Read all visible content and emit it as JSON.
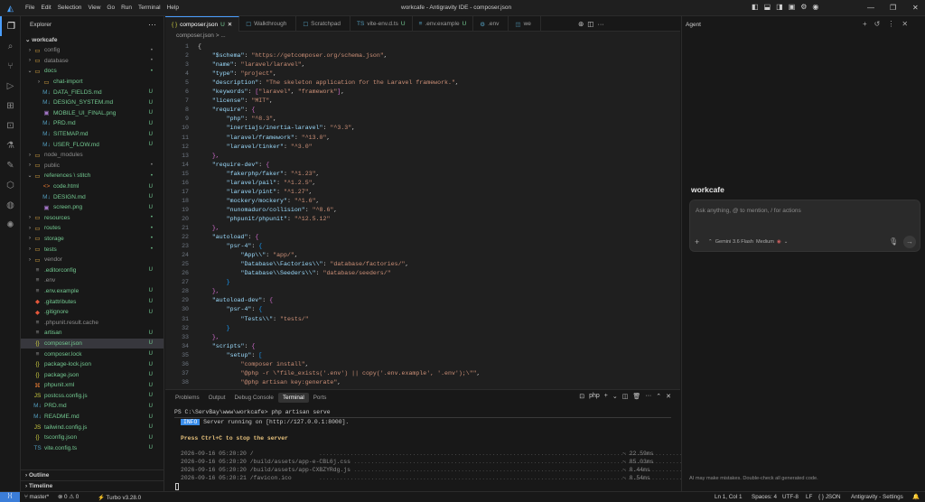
{
  "titlebar": {
    "menu": [
      "File",
      "Edit",
      "Selection",
      "View",
      "Go",
      "Run",
      "Terminal",
      "Help"
    ],
    "title": "workcafe - Antigravity IDE - composer.json"
  },
  "sidebar": {
    "title": "Explorer",
    "workspace": "workcafe",
    "items": [
      {
        "label": "config",
        "depth": 1,
        "kind": "folder",
        "open": false,
        "status": "•",
        "color": "grey"
      },
      {
        "label": "database",
        "depth": 1,
        "kind": "folder",
        "open": false,
        "status": "•",
        "color": "grey"
      },
      {
        "label": "docs",
        "depth": 1,
        "kind": "folder",
        "open": true,
        "status": "•",
        "color": "green"
      },
      {
        "label": "chat-import",
        "depth": 2,
        "kind": "folder",
        "open": false,
        "status": "",
        "color": "green"
      },
      {
        "label": "DATA_FIELDS.md",
        "depth": 2,
        "kind": "md",
        "status": "U",
        "color": "green"
      },
      {
        "label": "DESIGN_SYSTEM.md",
        "depth": 2,
        "kind": "md",
        "status": "U",
        "color": "green"
      },
      {
        "label": "MOBILE_UI_FINAL.png",
        "depth": 2,
        "kind": "png",
        "status": "U",
        "color": "green"
      },
      {
        "label": "PRD.md",
        "depth": 2,
        "kind": "md",
        "status": "U",
        "color": "green"
      },
      {
        "label": "SITEMAP.md",
        "depth": 2,
        "kind": "md",
        "status": "U",
        "color": "green"
      },
      {
        "label": "USER_FLOW.md",
        "depth": 2,
        "kind": "md",
        "status": "U",
        "color": "green"
      },
      {
        "label": "node_modules",
        "depth": 1,
        "kind": "folder",
        "open": false,
        "status": "",
        "color": "grey"
      },
      {
        "label": "public",
        "depth": 1,
        "kind": "folder",
        "open": false,
        "status": "•",
        "color": "grey"
      },
      {
        "label": "references \\ stitch",
        "depth": 1,
        "kind": "folder",
        "open": true,
        "status": "•",
        "color": "green"
      },
      {
        "label": "code.html",
        "depth": 2,
        "kind": "html",
        "status": "U",
        "color": "green"
      },
      {
        "label": "DESIGN.md",
        "depth": 2,
        "kind": "md",
        "status": "U",
        "color": "green"
      },
      {
        "label": "screen.png",
        "depth": 2,
        "kind": "png",
        "status": "U",
        "color": "green"
      },
      {
        "label": "resources",
        "depth": 1,
        "kind": "folder",
        "open": false,
        "status": "•",
        "color": "green"
      },
      {
        "label": "routes",
        "depth": 1,
        "kind": "folder",
        "open": false,
        "status": "•",
        "color": "green"
      },
      {
        "label": "storage",
        "depth": 1,
        "kind": "folder",
        "open": false,
        "status": "•",
        "color": "green"
      },
      {
        "label": "tests",
        "depth": 1,
        "kind": "folder",
        "open": false,
        "status": "•",
        "color": "green"
      },
      {
        "label": "vendor",
        "depth": 1,
        "kind": "folder",
        "open": false,
        "status": "",
        "color": "grey"
      },
      {
        "label": ".editorconfig",
        "depth": 1,
        "kind": "cfg",
        "status": "U",
        "color": "green"
      },
      {
        "label": ".env",
        "depth": 1,
        "kind": "cfg",
        "status": "",
        "color": "grey"
      },
      {
        "label": ".env.example",
        "depth": 1,
        "kind": "cfg",
        "status": "U",
        "color": "green"
      },
      {
        "label": ".gitattributes",
        "depth": 1,
        "kind": "git",
        "status": "U",
        "color": "green"
      },
      {
        "label": ".gitignore",
        "depth": 1,
        "kind": "git",
        "status": "U",
        "color": "green"
      },
      {
        "label": ".phpunit.result.cache",
        "depth": 1,
        "kind": "cfg",
        "status": "",
        "color": "grey"
      },
      {
        "label": "artisan",
        "depth": 1,
        "kind": "cfg",
        "status": "U",
        "color": "green"
      },
      {
        "label": "composer.json",
        "depth": 1,
        "kind": "json",
        "status": "U",
        "color": "green",
        "selected": true
      },
      {
        "label": "composer.lock",
        "depth": 1,
        "kind": "cfg",
        "status": "U",
        "color": "green"
      },
      {
        "label": "package-lock.json",
        "depth": 1,
        "kind": "json",
        "status": "U",
        "color": "green"
      },
      {
        "label": "package.json",
        "depth": 1,
        "kind": "json",
        "status": "U",
        "color": "green"
      },
      {
        "label": "phpunit.xml",
        "depth": 1,
        "kind": "xml",
        "status": "U",
        "color": "green"
      },
      {
        "label": "postcss.config.js",
        "depth": 1,
        "kind": "js",
        "status": "U",
        "color": "green"
      },
      {
        "label": "PRD.md",
        "depth": 1,
        "kind": "md",
        "status": "U",
        "color": "green"
      },
      {
        "label": "README.md",
        "depth": 1,
        "kind": "md",
        "status": "U",
        "color": "green"
      },
      {
        "label": "tailwind.config.js",
        "depth": 1,
        "kind": "js",
        "status": "U",
        "color": "green"
      },
      {
        "label": "tsconfig.json",
        "depth": 1,
        "kind": "json",
        "status": "U",
        "color": "green"
      },
      {
        "label": "vite.config.ts",
        "depth": 1,
        "kind": "ts",
        "status": "U",
        "color": "green"
      }
    ],
    "outline": "Outline",
    "timeline": "Timeline"
  },
  "tabs": [
    {
      "label": "composer.json",
      "status": "U",
      "icon": "{ }",
      "active": true
    },
    {
      "label": "Walkthrough",
      "status": "",
      "icon": "☐"
    },
    {
      "label": "Scratchpad",
      "status": "",
      "icon": "☐"
    },
    {
      "label": "vite-env.d.ts",
      "status": "U",
      "icon": "TS"
    },
    {
      "label": ".env.example",
      "status": "U",
      "icon": "≡"
    },
    {
      "label": ".env",
      "status": "",
      "icon": "⚙"
    },
    {
      "label": "we",
      "status": "",
      "icon": "◫"
    }
  ],
  "breadcrumb": "composer.json > ...",
  "code": [
    [
      [
        "p",
        "{"
      ]
    ],
    [
      [
        "k",
        "    \"$schema\""
      ],
      [
        "p",
        ": "
      ],
      [
        "s",
        "\"https://getcomposer.org/schema.json\""
      ],
      [
        "p",
        ","
      ]
    ],
    [
      [
        "k",
        "    \"name\""
      ],
      [
        "p",
        ": "
      ],
      [
        "s",
        "\"laravel/laravel\""
      ],
      [
        "p",
        ","
      ]
    ],
    [
      [
        "k",
        "    \"type\""
      ],
      [
        "p",
        ": "
      ],
      [
        "s",
        "\"project\""
      ],
      [
        "p",
        ","
      ]
    ],
    [
      [
        "k",
        "    \"description\""
      ],
      [
        "p",
        ": "
      ],
      [
        "s",
        "\"The skeleton application for the Laravel framework.\""
      ],
      [
        "p",
        ","
      ]
    ],
    [
      [
        "k",
        "    \"keywords\""
      ],
      [
        "p",
        ": "
      ],
      [
        "b2",
        "["
      ],
      [
        "s",
        "\"laravel\""
      ],
      [
        "p",
        ", "
      ],
      [
        "s",
        "\"framework\""
      ],
      [
        "b2",
        "]"
      ],
      [
        "p",
        ","
      ]
    ],
    [
      [
        "k",
        "    \"license\""
      ],
      [
        "p",
        ": "
      ],
      [
        "s",
        "\"MIT\""
      ],
      [
        "p",
        ","
      ]
    ],
    [
      [
        "k",
        "    \"require\""
      ],
      [
        "p",
        ": "
      ],
      [
        "b2",
        "{"
      ]
    ],
    [
      [
        "k",
        "        \"php\""
      ],
      [
        "p",
        ": "
      ],
      [
        "s",
        "\"^8.3\""
      ],
      [
        "p",
        ","
      ]
    ],
    [
      [
        "k",
        "        \"inertiajs/inertia-laravel\""
      ],
      [
        "p",
        ": "
      ],
      [
        "s",
        "\"^3.3\""
      ],
      [
        "p",
        ","
      ]
    ],
    [
      [
        "k",
        "        \"laravel/framework\""
      ],
      [
        "p",
        ": "
      ],
      [
        "s",
        "\"^13.0\""
      ],
      [
        "p",
        ","
      ]
    ],
    [
      [
        "k",
        "        \"laravel/tinker\""
      ],
      [
        "p",
        ": "
      ],
      [
        "s",
        "\"^3.0\""
      ]
    ],
    [
      [
        "b2",
        "    },"
      ]
    ],
    [
      [
        "k",
        "    \"require-dev\""
      ],
      [
        "p",
        ": "
      ],
      [
        "b2",
        "{"
      ]
    ],
    [
      [
        "k",
        "        \"fakerphp/faker\""
      ],
      [
        "p",
        ": "
      ],
      [
        "s",
        "\"^1.23\""
      ],
      [
        "p",
        ","
      ]
    ],
    [
      [
        "k",
        "        \"laravel/pail\""
      ],
      [
        "p",
        ": "
      ],
      [
        "s",
        "\"^1.2.5\""
      ],
      [
        "p",
        ","
      ]
    ],
    [
      [
        "k",
        "        \"laravel/pint\""
      ],
      [
        "p",
        ": "
      ],
      [
        "s",
        "\"^1.27\""
      ],
      [
        "p",
        ","
      ]
    ],
    [
      [
        "k",
        "        \"mockery/mockery\""
      ],
      [
        "p",
        ": "
      ],
      [
        "s",
        "\"^1.6\""
      ],
      [
        "p",
        ","
      ]
    ],
    [
      [
        "k",
        "        \"nunomaduro/collision\""
      ],
      [
        "p",
        ": "
      ],
      [
        "s",
        "\"^8.6\""
      ],
      [
        "p",
        ","
      ]
    ],
    [
      [
        "k",
        "        \"phpunit/phpunit\""
      ],
      [
        "p",
        ": "
      ],
      [
        "s",
        "\"^12.5.12\""
      ]
    ],
    [
      [
        "b2",
        "    },"
      ]
    ],
    [
      [
        "k",
        "    \"autoload\""
      ],
      [
        "p",
        ": "
      ],
      [
        "b2",
        "{"
      ]
    ],
    [
      [
        "k",
        "        \"psr-4\""
      ],
      [
        "p",
        ": "
      ],
      [
        "b3",
        "{"
      ]
    ],
    [
      [
        "k",
        "            \"App\\\\\""
      ],
      [
        "p",
        ": "
      ],
      [
        "s",
        "\"app/\""
      ],
      [
        "p",
        ","
      ]
    ],
    [
      [
        "k",
        "            \"Database\\\\Factories\\\\\""
      ],
      [
        "p",
        ": "
      ],
      [
        "s",
        "\"database/factories/\""
      ],
      [
        "p",
        ","
      ]
    ],
    [
      [
        "k",
        "            \"Database\\\\Seeders\\\\\""
      ],
      [
        "p",
        ": "
      ],
      [
        "s",
        "\"database/seeders/\""
      ]
    ],
    [
      [
        "b3",
        "        }"
      ]
    ],
    [
      [
        "b2",
        "    },"
      ]
    ],
    [
      [
        "k",
        "    \"autoload-dev\""
      ],
      [
        "p",
        ": "
      ],
      [
        "b2",
        "{"
      ]
    ],
    [
      [
        "k",
        "        \"psr-4\""
      ],
      [
        "p",
        ": "
      ],
      [
        "b3",
        "{"
      ]
    ],
    [
      [
        "k",
        "            \"Tests\\\\\""
      ],
      [
        "p",
        ": "
      ],
      [
        "s",
        "\"tests/\""
      ]
    ],
    [
      [
        "b3",
        "        }"
      ]
    ],
    [
      [
        "b2",
        "    },"
      ]
    ],
    [
      [
        "k",
        "    \"scripts\""
      ],
      [
        "p",
        ": "
      ],
      [
        "b2",
        "{"
      ]
    ],
    [
      [
        "k",
        "        \"setup\""
      ],
      [
        "p",
        ": "
      ],
      [
        "b3",
        "["
      ]
    ],
    [
      [
        "s",
        "            \"composer install\""
      ],
      [
        "p",
        ","
      ]
    ],
    [
      [
        "s",
        "            \"@php -r \\\"file_exists('.env') || copy('.env.example', '.env');\\\"\""
      ],
      [
        "p",
        ","
      ]
    ],
    [
      [
        "s",
        "            \"@php artisan key:generate\""
      ],
      [
        "p",
        ","
      ]
    ]
  ],
  "panel": {
    "tabs": [
      "Problems",
      "Output",
      "Debug Console",
      "Terminal",
      "Ports"
    ],
    "active": "Terminal",
    "shell": "php"
  },
  "terminal": {
    "prompt": "PS C:\\ServBay\\www\\workcafe> php artisan serve",
    "info_badge": "INFO",
    "info_text": " Server running on [http://127.0.0.1:8000].",
    "stop": "Press Ctrl+C to stop the server",
    "logs": [
      {
        "t": "2026-09-16 05:20:20 /",
        "d": "~ 22.59ms"
      },
      {
        "t": "2026-09-16 05:20:20 /build/assets/app-e-CBL6j.css",
        "d": "~ 85.03ms"
      },
      {
        "t": "2026-09-16 05:20:20 /build/assets/app-CXBZYRdg.js",
        "d": "~ 0.44ms"
      },
      {
        "t": "2026-09-16 05:20:21 /favicon.ico",
        "d": "~ 0.54ms"
      }
    ]
  },
  "agent": {
    "title": "Agent",
    "workspace": "workcafe",
    "placeholder": "Ask anything, @ to mention, / for actions",
    "model": "Gemini 3.6 Flash",
    "mode": "Medium",
    "disclaimer": "AI may make mistakes. Double-check all generated code."
  },
  "status": {
    "branch": "master*",
    "errors": "0",
    "warnings": "0",
    "turbo": "Turbo v3.28.0",
    "position": "Ln 1, Col 1",
    "spaces": "Spaces: 4",
    "encoding": "UTF-8",
    "eol": "LF",
    "lang": "JSON",
    "settings": "Antigravity - Settings"
  }
}
